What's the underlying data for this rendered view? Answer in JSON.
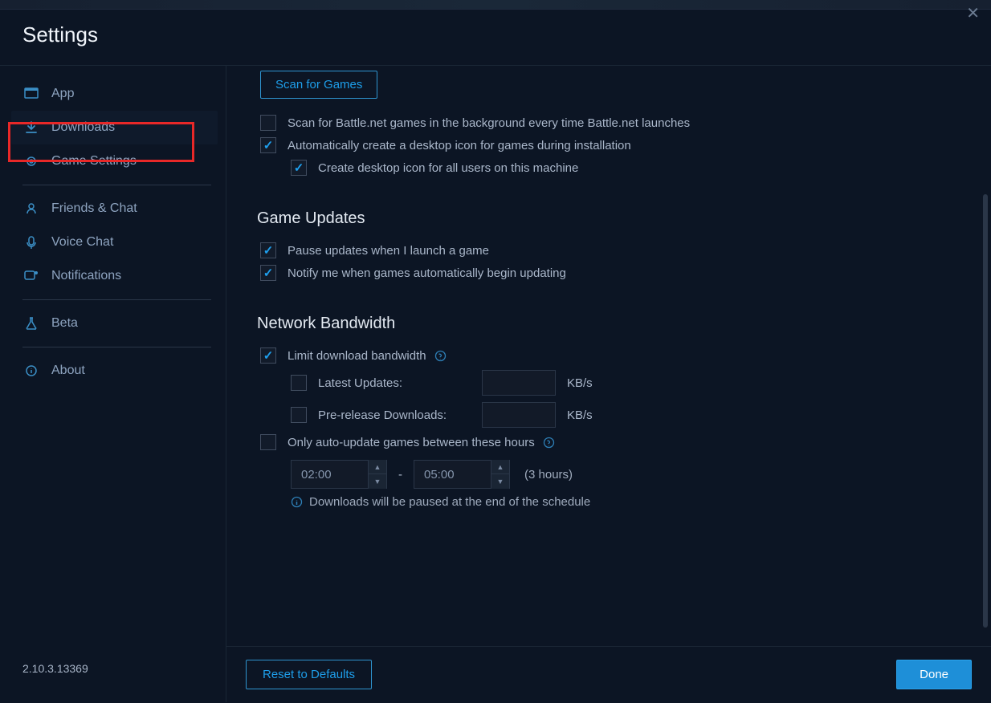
{
  "header": {
    "title": "Settings"
  },
  "sidebar": {
    "items": [
      {
        "label": "App"
      },
      {
        "label": "Downloads"
      },
      {
        "label": "Game Settings"
      },
      {
        "label": "Friends & Chat"
      },
      {
        "label": "Voice Chat"
      },
      {
        "label": "Notifications"
      },
      {
        "label": "Beta"
      },
      {
        "label": "About"
      }
    ],
    "version": "2.10.3.13369"
  },
  "content": {
    "scan_button": "Scan for Games",
    "scan_bg_label": "Scan for Battle.net games in the background every time Battle.net launches",
    "auto_icon_label": "Automatically create a desktop icon for games during installation",
    "all_users_label": "Create desktop icon for all users on this machine",
    "updates_title": "Game Updates",
    "pause_label": "Pause updates when I launch a game",
    "notify_label": "Notify me when games automatically begin updating",
    "bandwidth_title": "Network Bandwidth",
    "limit_label": "Limit download bandwidth",
    "latest_label": "Latest Updates:",
    "prerelease_label": "Pre-release Downloads:",
    "kbs": "KB/s",
    "hours_label": "Only auto-update games between these hours",
    "time_start": "02:00",
    "time_end": "05:00",
    "duration": "(3 hours)",
    "info_line": "Downloads will be paused at the end of the schedule"
  },
  "footer": {
    "reset": "Reset to Defaults",
    "done": "Done"
  }
}
